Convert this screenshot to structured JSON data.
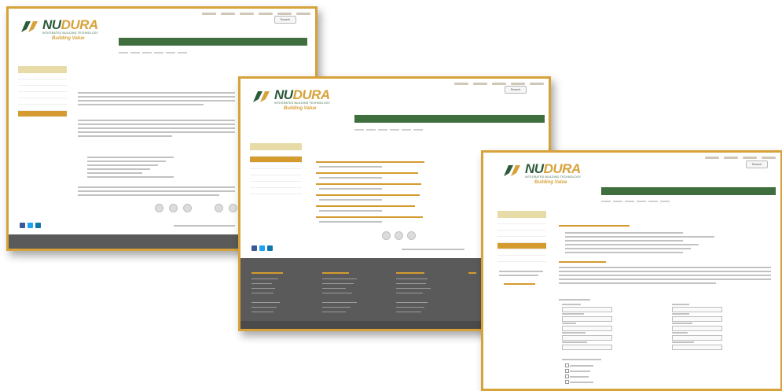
{
  "brand": {
    "name_part1": "NU",
    "name_part2": "DURA",
    "subtitle": "INTEGRATED BUILDING TECHNOLOGY",
    "tagline": "Building Value"
  },
  "colors": {
    "accent": "#d59b2f",
    "nav_green": "#3f6f3f",
    "frame_border": "#d7a23a",
    "footer": "#5a5a5a"
  },
  "search": {
    "label": "Search"
  },
  "screen1": {
    "nav_main": [
      "",
      "",
      "",
      "",
      "",
      ""
    ],
    "nav_sub": [
      "",
      "",
      "",
      "",
      "",
      ""
    ],
    "sidebar_title": "",
    "sidebar_items": [
      "",
      "",
      "",
      "",
      "",
      "",
      ""
    ],
    "page_title": "",
    "breadcrumb": "",
    "intro_link": "",
    "section_heading": ""
  },
  "screen2": {
    "nav_main": [
      "",
      "",
      "",
      "",
      "",
      ""
    ],
    "nav_sub": [
      "",
      "",
      "",
      "",
      "",
      ""
    ],
    "sidebar_title": "",
    "sidebar_items": [
      "",
      "",
      "",
      "",
      "",
      "",
      ""
    ],
    "page_title": "",
    "breadcrumb": "",
    "courses": [
      {
        "title": "",
        "details": ""
      },
      {
        "title": "",
        "details": ""
      },
      {
        "title": "",
        "details": ""
      },
      {
        "title": "",
        "details": ""
      },
      {
        "title": "",
        "details": ""
      },
      {
        "title": "",
        "details": ""
      }
    ],
    "footer_columns": [
      "",
      "",
      "",
      ""
    ]
  },
  "screen3": {
    "nav_main": [
      "",
      "",
      "",
      "",
      "",
      ""
    ],
    "nav_sub": [
      "",
      "",
      "",
      "",
      "",
      ""
    ],
    "sidebar_title": "",
    "sidebar_items": [
      "",
      "",
      "",
      "",
      "",
      "",
      ""
    ],
    "page_title": "",
    "breadcrumb": "",
    "section_heading_1": "",
    "section_heading_2": "",
    "form_left_labels": [
      "",
      "",
      "",
      "",
      ""
    ],
    "form_right_labels": [
      "",
      "",
      "",
      "",
      ""
    ],
    "checkbox_heading": "",
    "checkbox_options": [
      "",
      "",
      "",
      ""
    ]
  }
}
